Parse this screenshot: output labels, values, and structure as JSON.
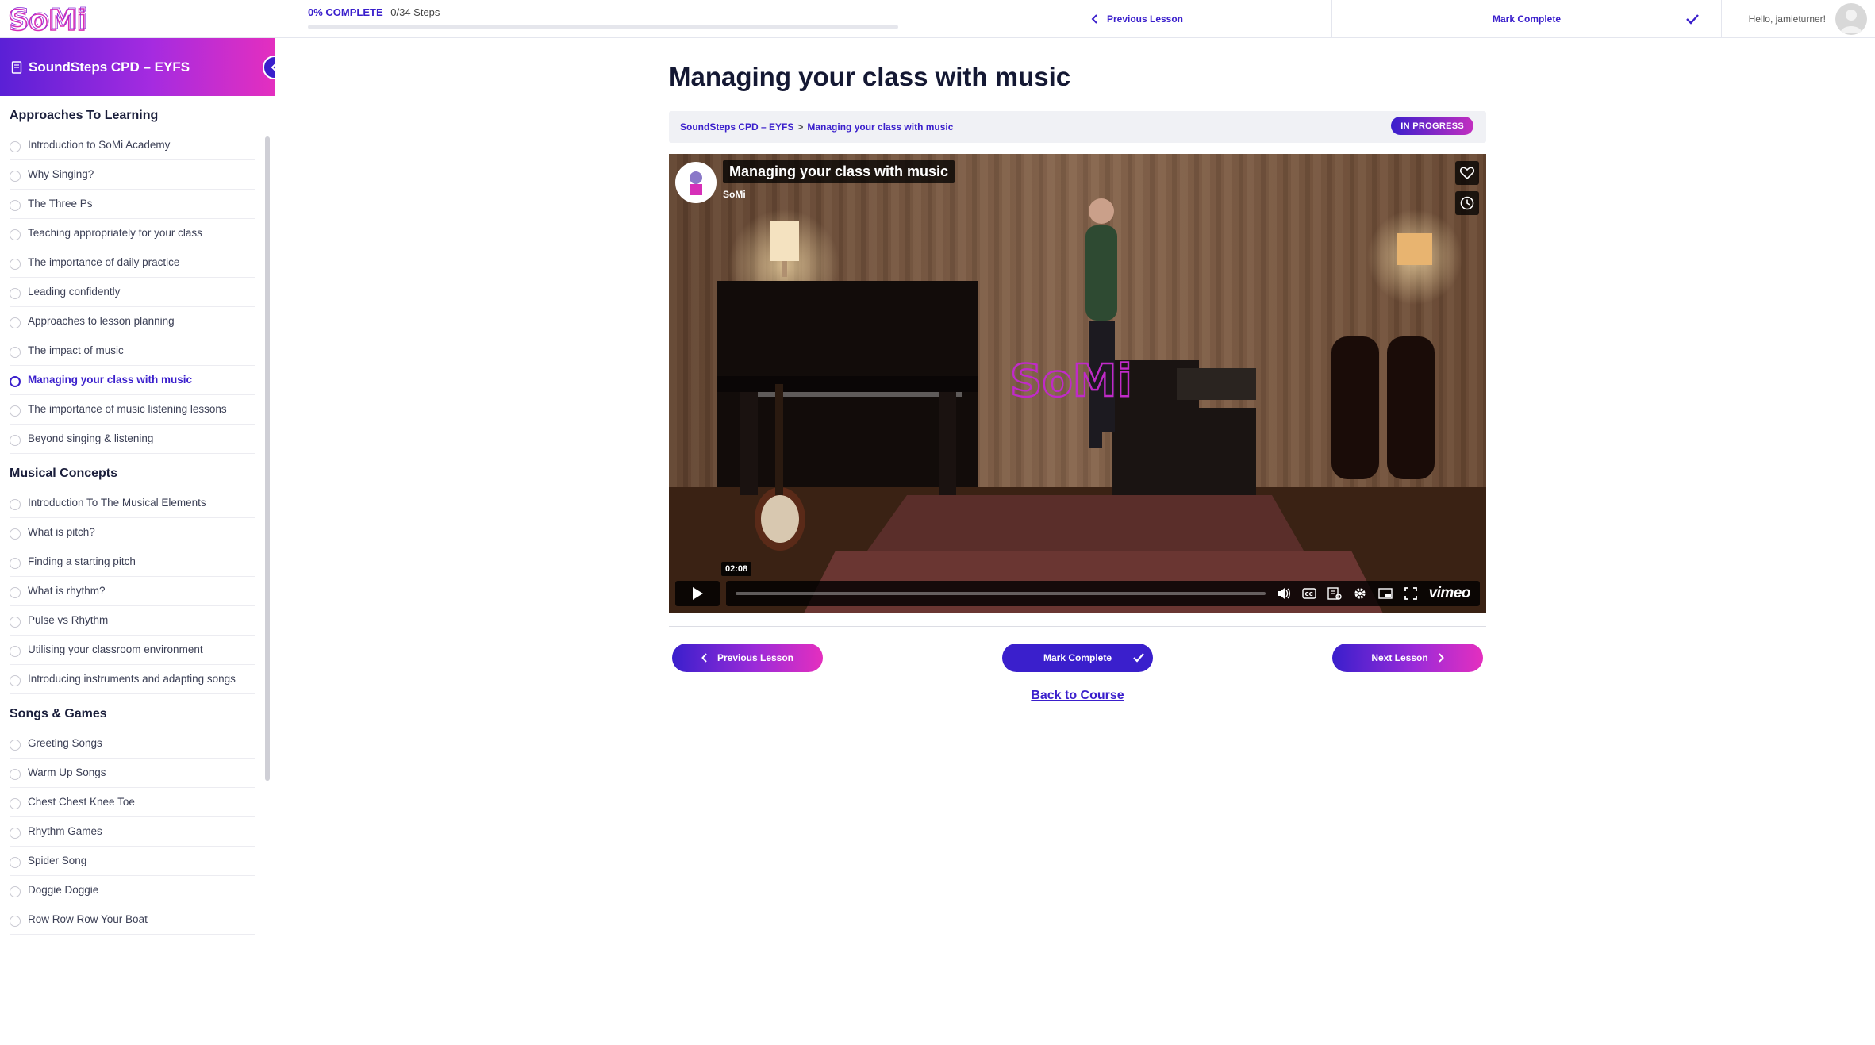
{
  "brand": {
    "logo_text": "SoMi",
    "colors": {
      "primary": "#3a1fcc",
      "magenta": "#e42fbf",
      "logo_pink": "#d62fb8"
    }
  },
  "topbar": {
    "progress_percent_label": "0% COMPLETE",
    "progress_steps": "0/34 Steps",
    "progress_fraction": 0,
    "prev_label": "Previous Lesson",
    "mark_label": "Mark Complete",
    "greeting": "Hello, jamieturner!"
  },
  "sidebar": {
    "course_title": "SoundSteps CPD – EYFS",
    "sections": [
      {
        "title": "Approaches To Learning",
        "lessons": [
          "Introduction to SoMi Academy",
          "Why Singing?",
          "The Three Ps",
          "Teaching appropriately for your class",
          "The importance of daily practice",
          "Leading confidently",
          "Approaches to lesson planning",
          "The impact of music",
          "Managing your class with music",
          "The importance of music listening lessons",
          "Beyond singing & listening"
        ]
      },
      {
        "title": "Musical Concepts",
        "lessons": [
          "Introduction To The Musical Elements",
          "What is pitch?",
          "Finding a starting pitch",
          "What is rhythm?",
          "Pulse vs Rhythm",
          "Utilising your classroom environment",
          "Introducing instruments and adapting songs"
        ]
      },
      {
        "title": "Songs & Games",
        "lessons": [
          "Greeting Songs",
          "Warm Up Songs",
          "Chest Chest Knee Toe",
          "Rhythm Games",
          "Spider Song",
          "Doggie Doggie",
          "Row Row Row Your Boat"
        ]
      }
    ],
    "current_lesson": "Managing your class with music"
  },
  "main": {
    "title": "Managing your class with music",
    "breadcrumb": [
      "SoundSteps CPD – EYFS",
      "Managing your class with music"
    ],
    "breadcrumb_separator": ">",
    "status": "IN PROGRESS",
    "video": {
      "title": "Managing your class with music",
      "channel": "SoMi",
      "time": "02:08",
      "provider": "vimeo",
      "watermark": "SoMi"
    },
    "prev_label": "Previous Lesson",
    "mark_label": "Mark Complete",
    "next_label": "Next Lesson",
    "back_label": "Back to Course"
  }
}
